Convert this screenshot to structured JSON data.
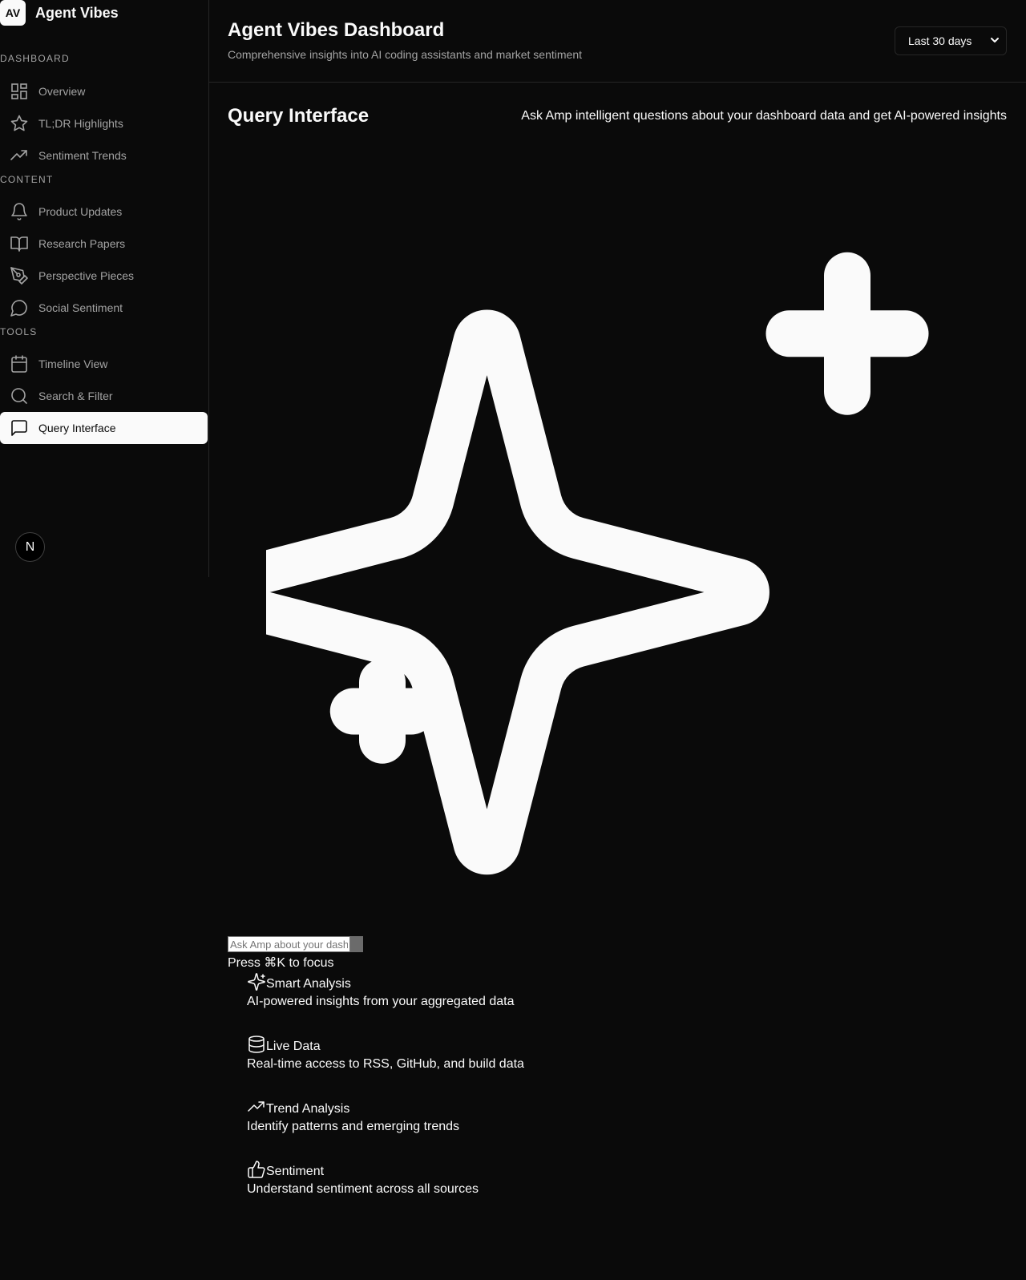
{
  "brand": {
    "logo": "AV",
    "name": "Agent Vibes"
  },
  "sidebar": {
    "groups": [
      {
        "label": "DASHBOARD",
        "items": [
          {
            "label": "Overview",
            "icon": "layout-grid-icon"
          },
          {
            "label": "TL;DR Highlights",
            "icon": "star-icon"
          },
          {
            "label": "Sentiment Trends",
            "icon": "trending-up-icon"
          }
        ]
      },
      {
        "label": "CONTENT",
        "items": [
          {
            "label": "Product Updates",
            "icon": "bell-icon"
          },
          {
            "label": "Research Papers",
            "icon": "book-open-icon"
          },
          {
            "label": "Perspective Pieces",
            "icon": "pen-tool-icon"
          },
          {
            "label": "Social Sentiment",
            "icon": "message-circle-icon"
          }
        ]
      },
      {
        "label": "TOOLS",
        "items": [
          {
            "label": "Timeline View",
            "icon": "calendar-icon"
          },
          {
            "label": "Search & Filter",
            "icon": "search-icon"
          },
          {
            "label": "Query Interface",
            "icon": "message-square-icon",
            "active": true
          }
        ]
      }
    ],
    "badge": "N"
  },
  "header": {
    "title": "Agent Vibes Dashboard",
    "subtitle": "Comprehensive insights into AI coding assistants and market sentiment",
    "range_selected": "Last 30 days"
  },
  "section": {
    "title": "Query Interface",
    "description": "Ask Amp intelligent questions about your dashboard data and get AI-powered insights"
  },
  "query": {
    "placeholder": "Ask Amp about your dashboard data...",
    "hint": "Press ⌘K to focus"
  },
  "features": [
    {
      "title": "Smart Analysis",
      "description": "AI-powered insights from your aggregated data",
      "icon": "sparkles-icon"
    },
    {
      "title": "Live Data",
      "description": "Real-time access to RSS, GitHub, and build data",
      "icon": "database-icon"
    },
    {
      "title": "Trend Analysis",
      "description": "Identify patterns and emerging trends",
      "icon": "trending-up-icon"
    },
    {
      "title": "Sentiment",
      "description": "Understand sentiment across all sources",
      "icon": "thumbs-up-icon"
    }
  ],
  "colors": {
    "background": "#0a0a0a",
    "foreground": "#fafafa",
    "muted": "#a3a3a3",
    "border": "#262626"
  }
}
